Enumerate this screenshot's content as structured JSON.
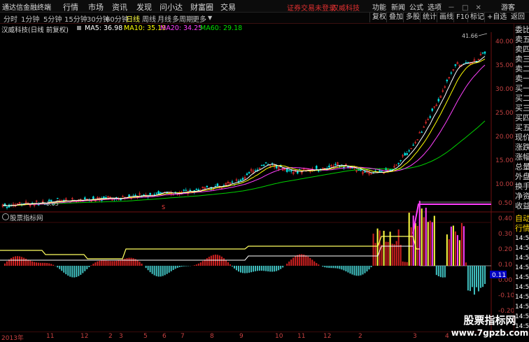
{
  "menubar": {
    "app_name": "通达信金融终端",
    "menus": [
      "行情",
      "市场",
      "资讯",
      "发现",
      "问小达",
      "财富圈",
      "交易"
    ],
    "login_notice": "证券交易未登录",
    "stock_name": "汉威科技",
    "right_menus": [
      "功能",
      "新闻",
      "公式",
      "选项"
    ],
    "user": "游客"
  },
  "toolbar": {
    "periods": [
      "分时",
      "1分钟",
      "5分钟",
      "15分钟",
      "30分钟",
      "60分钟",
      "日线",
      "周线",
      "月线",
      "多周期",
      "更多"
    ],
    "active_period": "日线",
    "right_buttons": [
      "复权",
      "叠加",
      "多股",
      "统计",
      "画线",
      "F10",
      "标记",
      "+自选",
      "返回"
    ]
  },
  "kline_info": {
    "title": "汉威科技(日线 前复权)",
    "ma5": "MA5: 36.98",
    "ma10": "MA10: 35.19",
    "ma20": "MA20: 34.25",
    "ma60": "MA60: 29.18",
    "low_mark": "6.05",
    "high_mark": "41.66",
    "event_mark": "S"
  },
  "price_axis": [
    "40.00",
    "35.00",
    "30.00",
    "25.00",
    "20.00",
    "15.00",
    "10.00"
  ],
  "sidebar_items": [
    "委比",
    "卖五",
    "卖四",
    "卖三",
    "卖二",
    "卖一",
    "买一",
    "买二",
    "买三",
    "买四",
    "买五",
    "现价",
    "涨跌",
    "涨幅",
    "总量",
    "外盘",
    "换手",
    "净资",
    "收益"
  ],
  "sub_indicator": {
    "title": "股票指标网",
    "axis": [
      "0.50",
      "0.40",
      "0.30",
      "0.20",
      "0.10",
      "0.00",
      "-0.10",
      "-0.20"
    ],
    "current_value": "0.11"
  },
  "sub_sidebar": [
    "自动",
    "行情",
    "14:50",
    "14:50",
    "14:50",
    "14:50",
    "14:50",
    "14:50",
    "14:50",
    "14:50",
    "14:50",
    "14:50",
    "14:50"
  ],
  "x_axis": [
    "2013年",
    "11",
    "12",
    "2",
    "3",
    "5",
    "6",
    "7",
    "8",
    "9",
    "10",
    "11",
    "12",
    "2",
    "3",
    "4"
  ],
  "colors": {
    "ma5": "#ffffff",
    "ma10": "#ffff00",
    "ma20": "#ff40ff",
    "ma60": "#00e000",
    "up": "#ff3030",
    "down": "#00ffff"
  },
  "watermark": {
    "line1": "股票指标网",
    "line2": "www.7gpzb.com"
  }
}
